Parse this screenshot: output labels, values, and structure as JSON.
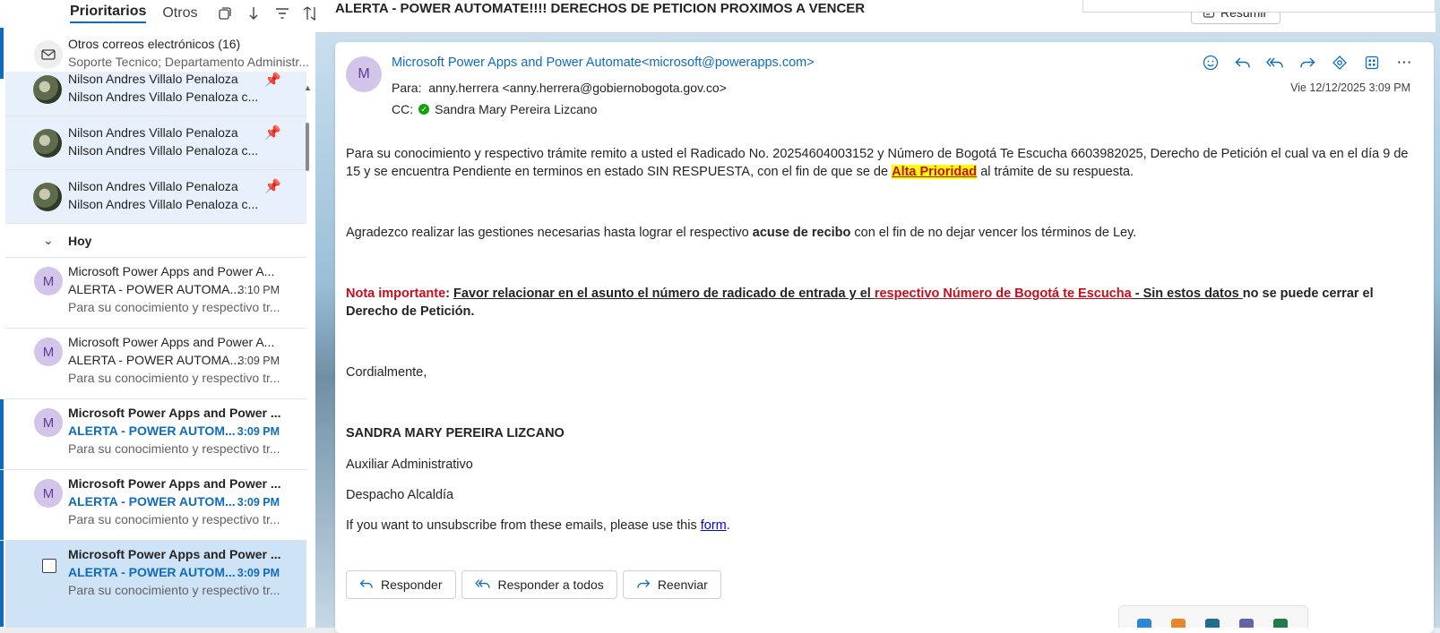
{
  "pivot": {
    "focused": "Prioritarios",
    "other": "Otros"
  },
  "other_mail": {
    "title": "Otros correos electrónicos (16)",
    "senders": "Soporte Tecnico; Departamento Administr..."
  },
  "pinned": [
    {
      "sender": "Nilson Andres Villalo Penaloza",
      "subject": "Nilson Andres Villalo Penaloza c..."
    },
    {
      "sender": "Nilson Andres Villalo Penaloza",
      "subject": "Nilson Andres Villalo Penaloza c..."
    },
    {
      "sender": "Nilson Andres Villalo Penaloza",
      "subject": "Nilson Andres Villalo Penaloza c..."
    }
  ],
  "group_header": "Hoy",
  "messages": [
    {
      "initial": "M",
      "sender": "Microsoft Power Apps and Power A...",
      "subject": "ALERTA - POWER AUTOMA...",
      "time": "3:10 PM",
      "preview": "Para su conocimiento y respectivo tr..."
    },
    {
      "initial": "M",
      "sender": "Microsoft Power Apps and Power A...",
      "subject": "ALERTA - POWER AUTOMA...",
      "time": "3:09 PM",
      "preview": "Para su conocimiento y respectivo tr..."
    },
    {
      "initial": "M",
      "sender": "Microsoft Power Apps and Power ...",
      "subject": "ALERTA - POWER AUTOM...",
      "time": "3:09 PM",
      "preview": "Para su conocimiento y respectivo tr..."
    },
    {
      "initial": "M",
      "sender": "Microsoft Power Apps and Power ...",
      "subject": "ALERTA - POWER AUTOM...",
      "time": "3:09 PM",
      "preview": "Para su conocimiento y respectivo tr..."
    },
    {
      "initial": "",
      "sender": "Microsoft Power Apps and Power ...",
      "subject": "ALERTA - POWER AUTOM...",
      "time": "3:09 PM",
      "preview": "Para su conocimiento y respectivo tr..."
    }
  ],
  "reading": {
    "subject": "ALERTA - POWER AUTOMATE!!!!  DERECHOS DE PETICION PROXIMOS A VENCER",
    "summarize": "Resumir",
    "avatar_initial": "M",
    "from": "Microsoft Power Apps and Power Automate<microsoft@powerapps.com>",
    "to_label": "Para:",
    "to": "anny.herrera <anny.herrera@gobiernobogota.gov.co>",
    "cc_label": "CC:",
    "cc": "Sandra Mary Pereira Lizcano",
    "date": "Vie 12/12/2025 3:09 PM",
    "body": {
      "p1_a": "Para su conocimiento y respectivo trámite remito a usted el Radicado No. 20254604003152 y Número de Bogotá Te Escucha 6603982025, Derecho de Petición el cual va en el día 9 de 15 y se encuentra Pendiente en terminos en estado SIN RESPUESTA, con el fin de que se de ",
      "p1_hl": "Alta Prioridad",
      "p1_b": " al trámite de su respuesta.",
      "p2_a": "Agradezco realizar las gestiones necesarias hasta lograr el respectivo ",
      "p2_b": "acuse de recibo",
      "p2_c": " con el fin de no dejar vencer los términos de Ley.",
      "note_label": "Nota importante",
      "note_colon": ": ",
      "note_u1": "Favor relacionar en el asunto el número de radicado de entrada y el ",
      "note_red": "respectivo Número de Bogotá te Escucha",
      "note_u2": " - Sin estos datos ",
      "note_tail": "no se puede cerrar el Derecho de Petición.",
      "closing": "Cordialmente,",
      "sig_name": "SANDRA MARY PEREIRA LIZCANO",
      "sig_role": "Auxiliar Administrativo",
      "sig_office": "Despacho Alcaldía",
      "unsub_a": "If you want to unsubscribe from these emails, please use this ",
      "unsub_link": "form",
      "unsub_b": "."
    },
    "reply": "Responder",
    "reply_all": "Responder a todos",
    "forward": "Reenviar"
  },
  "colors": {
    "accent": "#0f6cbd",
    "alert_red": "#c50f1f",
    "highlight": "#ffff00",
    "avatar_bg": "#d3c4ea"
  }
}
